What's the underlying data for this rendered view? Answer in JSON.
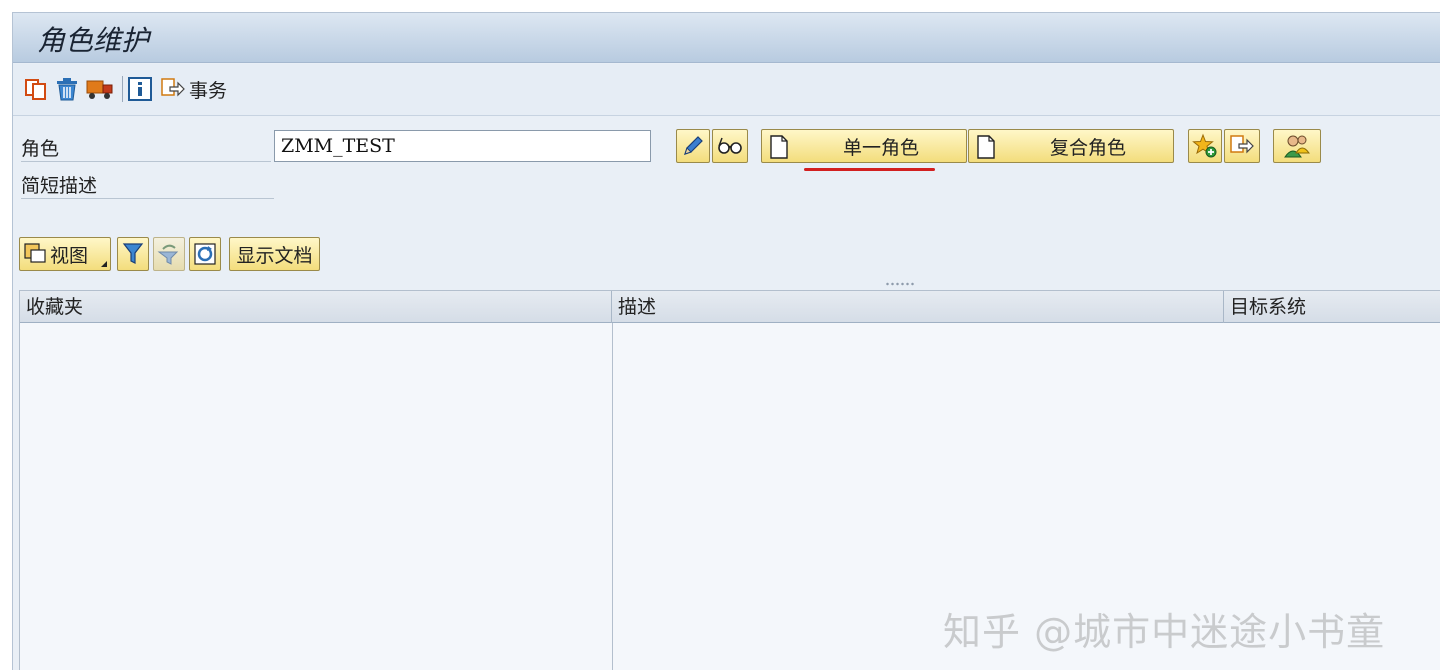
{
  "window": {
    "title": "角色维护"
  },
  "toolbar": {
    "icons": [
      "copy-icon",
      "delete-icon",
      "transport-icon",
      "info-icon",
      "transaction-icon"
    ],
    "transaction_label": "事务"
  },
  "form": {
    "role_label": "角色",
    "role_value": "ZMM_TEST",
    "short_desc_label": "简短描述",
    "single_role_label": "单一角色",
    "composite_role_label": "复合角色"
  },
  "list_toolbar": {
    "view_label": "视图",
    "show_doc_label": "显示文档"
  },
  "table": {
    "columns": [
      "收藏夹",
      "描述",
      "目标系统"
    ]
  },
  "watermark": {
    "text": "知乎 @城市中迷途小书童"
  },
  "colors": {
    "accent_red": "#d21f1f",
    "button_yellow": "#f3dd7c",
    "background": "#e9eff6"
  }
}
